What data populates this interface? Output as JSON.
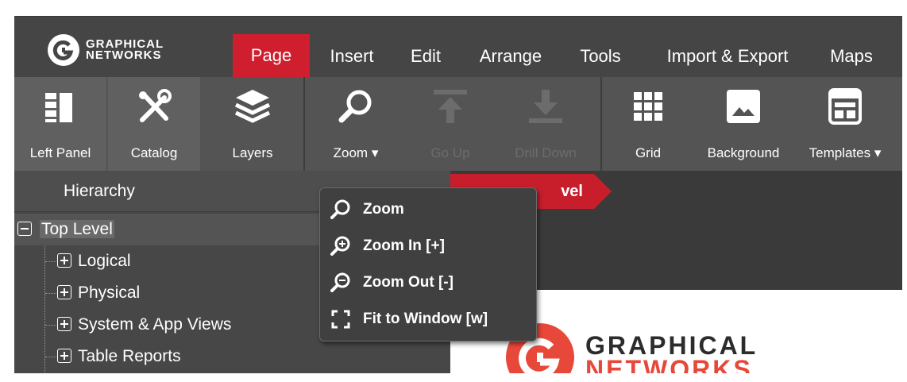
{
  "brand": {
    "line1": "GRAPHICAL",
    "line2": "NETWORKS"
  },
  "menu": {
    "page": "Page",
    "insert": "Insert",
    "edit": "Edit",
    "arrange": "Arrange",
    "tools": "Tools",
    "import_export": "Import & Export",
    "maps": "Maps",
    "active": "Page"
  },
  "toolbar": {
    "left_panel": "Left Panel",
    "catalog": "Catalog",
    "layers": "Layers",
    "zoom": "Zoom",
    "go_up": "Go Up",
    "drill_down": "Drill Down",
    "grid": "Grid",
    "background": "Background",
    "templates": "Templates"
  },
  "hierarchy": {
    "title": "Hierarchy",
    "root": "Top Level",
    "children": [
      "Logical",
      "Physical",
      "System & App Views",
      "Table Reports"
    ]
  },
  "breadcrumb": {
    "current": "Top Level",
    "visible_text": "vel"
  },
  "zoom_menu": {
    "zoom": "Zoom",
    "zoom_in": "Zoom In [+]",
    "zoom_out": "Zoom Out [-]",
    "fit": "Fit to Window [w]"
  },
  "colors": {
    "accent": "#cf1f2e",
    "logo_red": "#e8483a"
  }
}
